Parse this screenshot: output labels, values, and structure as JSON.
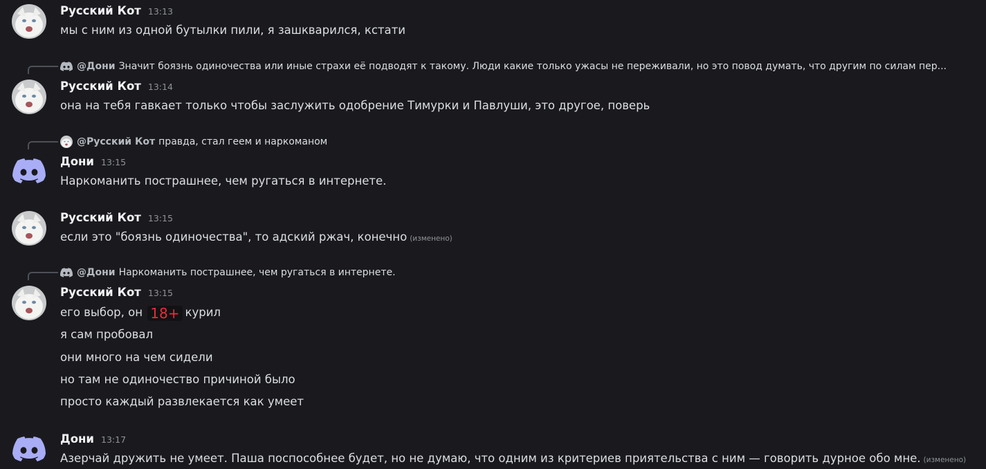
{
  "colors": {
    "background": "#1a1a1e",
    "discord_blurple": "#5865f2",
    "spoiler_text": "#ed2b3b"
  },
  "messages": [
    {
      "author": "Русский Кот",
      "time": "13:13",
      "avatar": "white-cat-avatar",
      "lines": [
        "мы с ним из одной бутылки пили, я зашкварился, кстати"
      ]
    },
    {
      "reply": {
        "icon": "discord-logo-icon",
        "mention": "@Дони",
        "text": "Значит боязнь одиночества или иные страхи её подводят к такому. Люди какие только ужасы не переживали, но это повод думать, что другим по силам пер..."
      },
      "author": "Русский Кот",
      "time": "13:14",
      "avatar": "white-cat-avatar",
      "lines": [
        "она на тебя гавкает только чтобы заслужить одобрение Тимурки и Павлуши, это другое, поверь"
      ]
    },
    {
      "reply": {
        "icon": "white-cat-avatar",
        "mention": "@Русский Кот",
        "text": "правда, стал геем и наркоманом"
      },
      "author": "Дони",
      "time": "13:15",
      "avatar": "discord-logo-avatar",
      "lines": [
        "Наркоманить пострашнее, чем ругаться в интернете."
      ]
    },
    {
      "author": "Русский Кот",
      "time": "13:15",
      "avatar": "white-cat-avatar",
      "lines": [
        "если это \"боязнь одиночества\", то адский ржач, конечно"
      ],
      "edited": "(изменено)"
    },
    {
      "reply": {
        "icon": "discord-logo-icon",
        "mention": "@Дони",
        "text": "Наркоманить пострашнее, чем ругаться в интернете."
      },
      "author": "Русский Кот",
      "time": "13:15",
      "avatar": "white-cat-avatar",
      "line1_before": "его выбор, он",
      "spoiler": "18+",
      "line1_after": "курил",
      "lines": [
        "я сам пробовал",
        "они много на чем сидели",
        "но там не одиночество причиной было",
        "просто каждый развлекается как умеет"
      ]
    },
    {
      "author": "Дони",
      "time": "13:17",
      "avatar": "discord-logo-avatar",
      "lines": [
        "Азерчай дружить не умеет. Паша поспособнее будет, но не думаю, что одним из критериев приятельства с ним — говорить дурное обо мне."
      ],
      "edited": "(изменено)"
    }
  ]
}
